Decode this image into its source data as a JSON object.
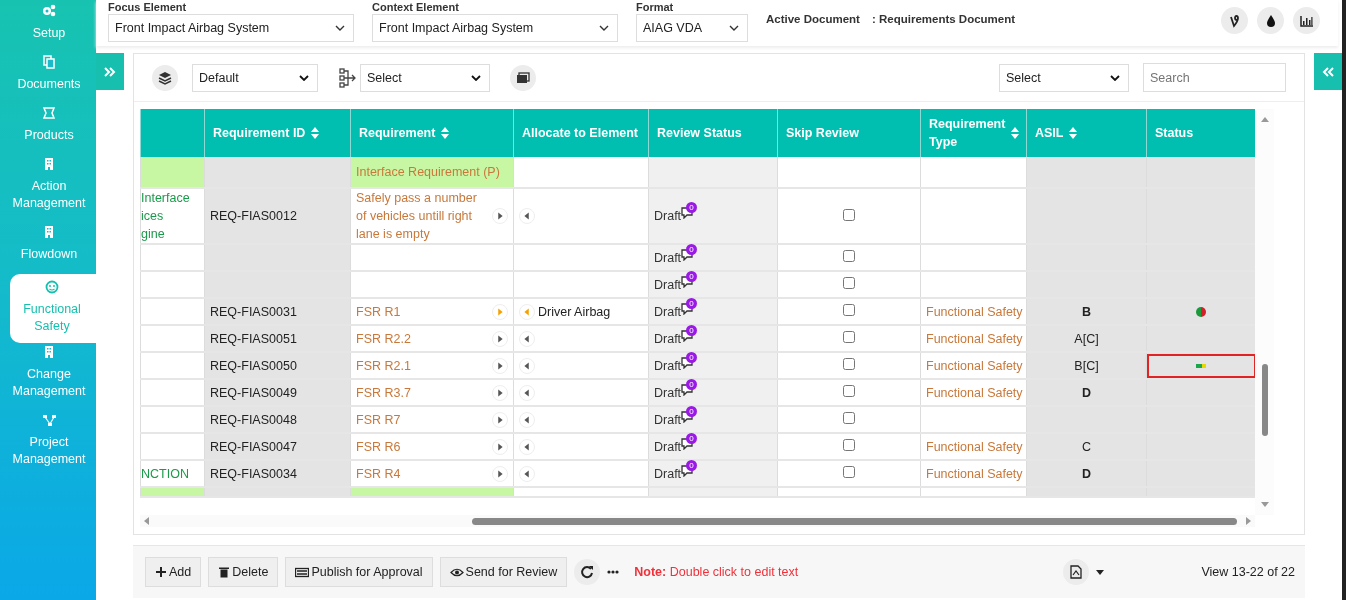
{
  "sidebar": {
    "items": [
      {
        "label": "Setup",
        "selected": false
      },
      {
        "label": "Documents",
        "selected": false
      },
      {
        "label": "Products",
        "selected": false
      },
      {
        "label": "Action Management",
        "selected": false
      },
      {
        "label": "Flowdown",
        "selected": false
      },
      {
        "label": "Functional Safety",
        "selected": true
      },
      {
        "label": "Change Management",
        "selected": false
      },
      {
        "label": "Project Management",
        "selected": false
      }
    ]
  },
  "header": {
    "fields": [
      {
        "label": "Focus Element",
        "value": "Front Impact Airbag System"
      },
      {
        "label": "Context Element",
        "value": "Front Impact Airbag System"
      },
      {
        "label": "Format",
        "value": "AIAG VDA"
      }
    ],
    "active_document": {
      "label": "Active Document",
      "value": ": Requirements Document"
    }
  },
  "toolbar": {
    "view_select": "Default",
    "group_select": "Select",
    "filter_select": "Select",
    "search": {
      "placeholder": "Search"
    }
  },
  "table": {
    "columns": [
      {},
      {
        "label": "Requirement ID",
        "sortable": true
      },
      {
        "label": "Requirement",
        "sortable": true
      },
      {
        "label": "Allocate to Element",
        "sortable": false
      },
      {
        "label": "Review Status",
        "sortable": false
      },
      {
        "label": "Skip Review",
        "sortable": false
      },
      {
        "label": "Requirement Type",
        "sortable": true
      },
      {
        "label": "ASIL",
        "sortable": true
      },
      {
        "label": "Status",
        "sortable": false
      }
    ],
    "rows": [
      {
        "kind": "group",
        "requirement": "Interface Requirement (P)"
      },
      {
        "kind": "item",
        "column_1": [
          "Interface",
          "ices",
          "gine"
        ],
        "id": "REQ-FIAS0012",
        "requirement": "Safely pass a number of vehicles untill right lane is empty",
        "arrows": true,
        "linked": false,
        "review": "Draft",
        "comments": "0",
        "skip": false
      },
      {
        "kind": "item",
        "review": "Draft",
        "comments": "0",
        "skip": false
      },
      {
        "kind": "item",
        "review": "Draft",
        "comments": "0",
        "skip": false
      },
      {
        "kind": "item",
        "id": "REQ-FIAS0031",
        "requirement": "FSR R1",
        "arrows": true,
        "linked": true,
        "element": "Driver Airbag",
        "review": "Draft",
        "comments": "0",
        "skip": false,
        "type": "Functional Safety",
        "asil": "B",
        "asil_bold": true,
        "status_dot": true
      },
      {
        "kind": "item",
        "id": "REQ-FIAS0051",
        "requirement": "FSR R2.2",
        "arrows": true,
        "linked": false,
        "review": "Draft",
        "comments": "0",
        "skip": false,
        "type": "Functional Safety",
        "asil": "A[C]",
        "asil_bold": false
      },
      {
        "kind": "item",
        "id": "REQ-FIAS0050",
        "requirement": "FSR R2.1",
        "arrows": true,
        "linked": false,
        "review": "Draft",
        "comments": "0",
        "skip": false,
        "type": "Functional Safety",
        "asil": "B[C]",
        "asil_bold": false,
        "status_bar": true,
        "marked": true
      },
      {
        "kind": "item",
        "id": "REQ-FIAS0049",
        "requirement": "FSR R3.7",
        "arrows": true,
        "linked": false,
        "review": "Draft",
        "comments": "0",
        "skip": false,
        "type": "Functional Safety",
        "asil": "D",
        "asil_bold": true
      },
      {
        "kind": "item",
        "id": "REQ-FIAS0048",
        "requirement": "FSR R7",
        "arrows": true,
        "linked": false,
        "review": "Draft",
        "comments": "0",
        "skip": false
      },
      {
        "kind": "item",
        "id": "REQ-FIAS0047",
        "requirement": "FSR R6",
        "arrows": true,
        "linked": false,
        "review": "Draft",
        "comments": "0",
        "skip": false,
        "type": "Functional Safety",
        "asil": "C",
        "asil_bold": false
      },
      {
        "kind": "item",
        "column_1": [
          "NCTION"
        ],
        "id": "REQ-FIAS0034",
        "requirement": "FSR R4",
        "arrows": true,
        "linked": false,
        "review": "Draft",
        "comments": "0",
        "skip": false,
        "type": "Functional Safety",
        "asil": "D",
        "asil_bold": true
      },
      {
        "kind": "group"
      }
    ]
  },
  "footer": {
    "buttons": [
      {
        "label": "Add"
      },
      {
        "label": "Delete"
      },
      {
        "label": "Publish for Approval"
      },
      {
        "label": "Send for Review"
      }
    ],
    "note": "**Note:** Double click to edit text",
    "pager": "View 13-22 of 22"
  }
}
